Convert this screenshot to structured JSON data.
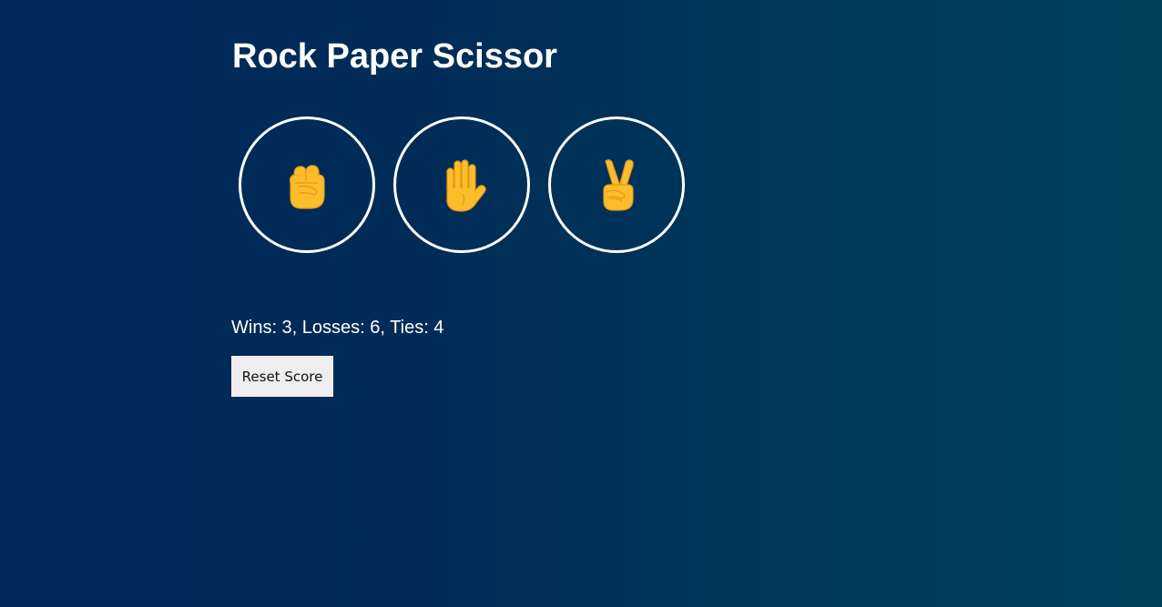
{
  "header": {
    "title": "Rock Paper Scissor"
  },
  "choices": [
    {
      "name": "rock",
      "icon": "raised-fist-icon"
    },
    {
      "name": "paper",
      "icon": "raised-hand-icon"
    },
    {
      "name": "scissors",
      "icon": "victory-hand-icon"
    }
  ],
  "score": {
    "text": "Wins: 3, Losses: 6, Ties: 4"
  },
  "controls": {
    "reset_label": "Reset Score"
  },
  "colors": {
    "background_start": "#00285a",
    "background_end": "#014159",
    "emoji_skin": "#fbbe2a",
    "emoji_outline": "#e5961a",
    "button_bg": "#efedef"
  }
}
